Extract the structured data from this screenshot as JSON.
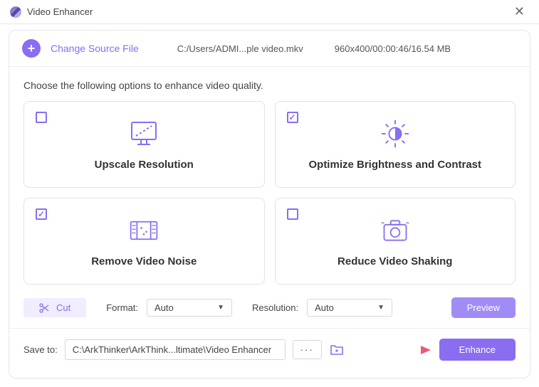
{
  "titlebar": {
    "app_title": "Video Enhancer"
  },
  "source": {
    "change_label": "Change Source File",
    "file_path": "C:/Users/ADMI...ple video.mkv",
    "file_info": "960x400/00:00:46/16.54 MB"
  },
  "instruction": "Choose the following options to enhance video quality.",
  "options": [
    {
      "label": "Upscale Resolution",
      "checked": false
    },
    {
      "label": "Optimize Brightness and Contrast",
      "checked": true
    },
    {
      "label": "Remove Video Noise",
      "checked": true
    },
    {
      "label": "Reduce Video Shaking",
      "checked": false
    }
  ],
  "controls": {
    "cut_label": "Cut",
    "format_label": "Format:",
    "format_value": "Auto",
    "resolution_label": "Resolution:",
    "resolution_value": "Auto",
    "preview_label": "Preview"
  },
  "save": {
    "label": "Save to:",
    "path": "C:\\ArkThinker\\ArkThink...ltimate\\Video Enhancer",
    "dots": "···",
    "enhance_label": "Enhance"
  }
}
